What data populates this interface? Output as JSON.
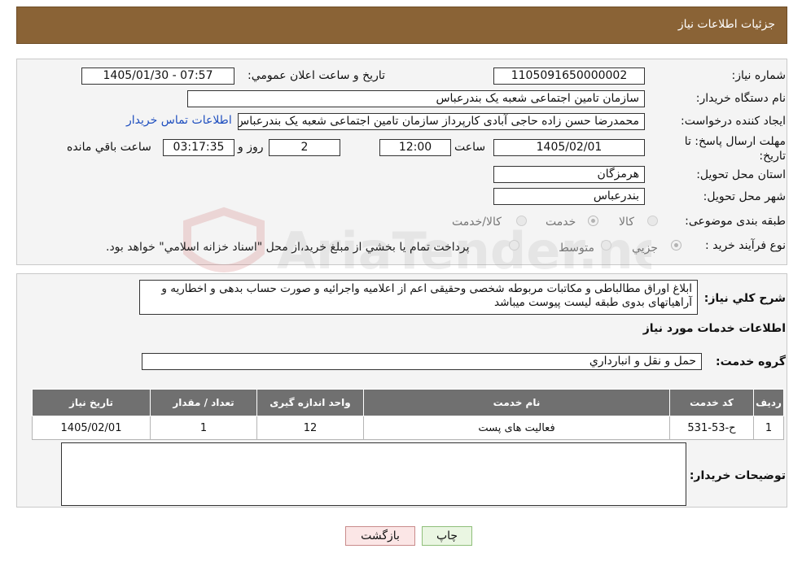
{
  "header": {
    "title": "جزئیات اطلاعات نیاز"
  },
  "form": {
    "need_number": {
      "label": "شماره نیاز:",
      "value": "1105091650000002"
    },
    "announce_date": {
      "label": "تاریخ و ساعت اعلان عمومي:",
      "value": "1405/01/30 - 07:57"
    },
    "buyer_org": {
      "label": "نام دستگاه خريدار:",
      "value": "سازمان تامین اجتماعی شعبه یک بندرعباس"
    },
    "requester": {
      "label": "ايجاد کننده درخواست:",
      "value": "محمدرضا حسن زاده حاجی آبادی کارپرداز سازمان تامین اجتماعی شعبه یک بندرعباس",
      "contact_link": "اطلاعات تماس خريدار"
    },
    "deadline": {
      "label": "مهلت ارسال پاسخ: تا تاريخ:",
      "date": "1405/02/01",
      "time_label": "ساعت",
      "time": "12:00",
      "days": "2",
      "days_label": "روز و",
      "remaining": "03:17:35",
      "remaining_label": "ساعت باقي مانده"
    },
    "province": {
      "label": "استان محل تحويل:",
      "value": "هرمزگان"
    },
    "city": {
      "label": "شهر محل تحويل:",
      "value": "بندرعباس"
    },
    "category": {
      "label": "طبقه بندی موضوعی:",
      "options": [
        "کالا",
        "خدمت",
        "کالا/خدمت"
      ],
      "selected": "خدمت"
    },
    "purchase_type": {
      "label": "نوع فرآيند خريد :",
      "options": [
        "جزيي",
        "متوسط"
      ],
      "selected": "جزيي",
      "note": "پرداخت تمام يا بخشي از مبلغ خريد،از محل \"اسناد خزانه اسلامي\" خواهد بود."
    }
  },
  "summary": {
    "label": "شرح کلي نياز:",
    "text": "ابلاغ اوراق مطالباطی و مکاتبات مربوطه شخصی وحقیقی اعم از اعلامیه واجرائیه و صورت حساب بدهی و اخطاریه و آراهیاتهای بدوی طبقه لیست پیوست میباشد"
  },
  "services": {
    "section_title": "اطلاعات خدمات مورد نياز",
    "group_label": "گروه خدمت:",
    "group_value": "حمل و نقل و انبارداري",
    "columns": [
      "رديف",
      "کد خدمت",
      "نام خدمت",
      "واحد اندازه گيری",
      "تعداد / مقدار",
      "تاريخ نياز"
    ],
    "rows": [
      [
        "1",
        "ح-53-531",
        "فعالیت های پست",
        "12",
        "1",
        "1405/02/01"
      ]
    ]
  },
  "buyer_notes": {
    "label": "توضيحات خريدار:",
    "value": ""
  },
  "buttons": {
    "print": "چاپ",
    "back": "بازگشت"
  },
  "watermark": {
    "text": "AriaTender.neT"
  },
  "colors": {
    "header_bg": "#8a6336",
    "table_header_bg": "#707070",
    "link": "#1f4fbf",
    "print_btn_bg": "#eaf6e2",
    "back_btn_bg": "#fbe6e6"
  }
}
